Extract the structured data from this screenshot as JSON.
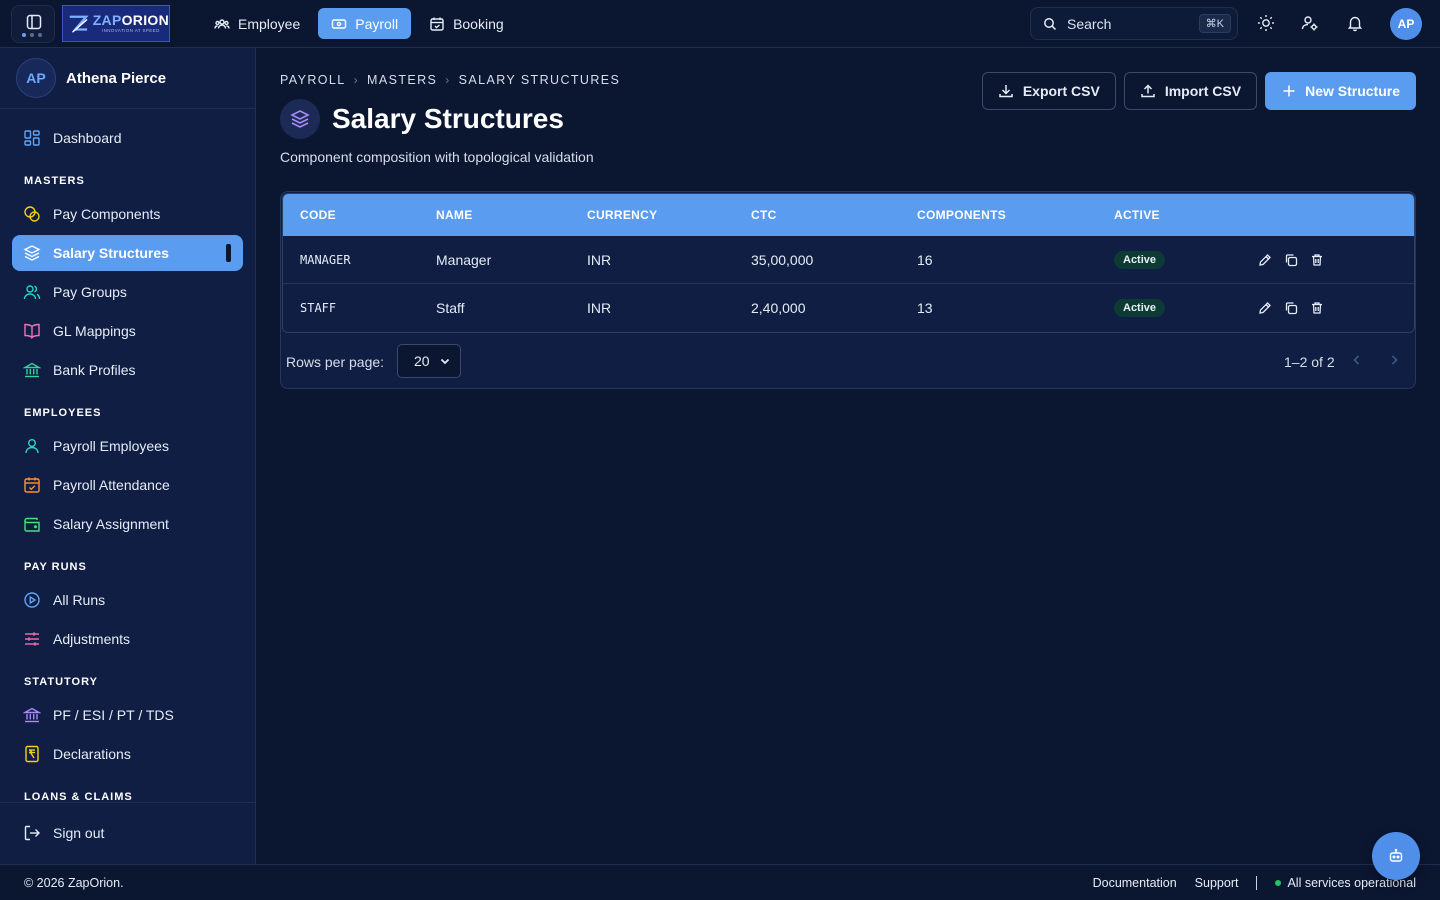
{
  "brand": {
    "name_a": "ZAP",
    "name_b": "ORION",
    "tagline": "INNOVATION AT SPEED"
  },
  "topnav": [
    {
      "label": "Employee",
      "icon": "people-icon",
      "active": false
    },
    {
      "label": "Payroll",
      "icon": "payroll-icon",
      "active": true
    },
    {
      "label": "Booking",
      "icon": "calendar-icon",
      "active": false
    }
  ],
  "search": {
    "placeholder": "Search",
    "shortcut": "⌘K"
  },
  "user": {
    "initials": "AP",
    "name": "Athena Pierce"
  },
  "sidebar": {
    "dashboard": "Dashboard",
    "sections": {
      "masters": "MASTERS",
      "employees": "EMPLOYEES",
      "pay_runs": "PAY RUNS",
      "statutory": "STATUTORY",
      "loans": "LOANS & CLAIMS"
    },
    "items": {
      "pay_components": "Pay Components",
      "salary_structures": "Salary Structures",
      "pay_groups": "Pay Groups",
      "gl_mappings": "GL Mappings",
      "bank_profiles": "Bank Profiles",
      "payroll_employees": "Payroll Employees",
      "payroll_attendance": "Payroll Attendance",
      "salary_assignment": "Salary Assignment",
      "all_runs": "All Runs",
      "adjustments": "Adjustments",
      "statutory_taxes": "PF / ESI / PT / TDS",
      "declarations": "Declarations"
    },
    "active": "salary_structures",
    "sign_out": "Sign out"
  },
  "breadcrumb": [
    "PAYROLL",
    "MASTERS",
    "SALARY STRUCTURES"
  ],
  "page": {
    "title": "Salary Structures",
    "subtitle": "Component composition with topological validation"
  },
  "actions": {
    "export": "Export CSV",
    "import": "Import CSV",
    "new": "New Structure"
  },
  "table": {
    "columns": [
      "CODE",
      "NAME",
      "CURRENCY",
      "CTC",
      "COMPONENTS",
      "ACTIVE"
    ],
    "rows": [
      {
        "code": "MANAGER",
        "name": "Manager",
        "currency": "INR",
        "ctc": "35,00,000",
        "components": "16",
        "active": "Active"
      },
      {
        "code": "STAFF",
        "name": "Staff",
        "currency": "INR",
        "ctc": "2,40,000",
        "components": "13",
        "active": "Active"
      }
    ],
    "rows_per_page_label": "Rows per page:",
    "rows_per_page": "20",
    "range": "1–2 of 2"
  },
  "footer": {
    "copyright": "© 2026 ZapOrion.",
    "documentation": "Documentation",
    "support": "Support",
    "status": "All services operational"
  },
  "colors": {
    "accent": "#5a9cf0",
    "background": "#0b1631",
    "sidebar": "#0f1e42",
    "status_ok": "#22c55e"
  }
}
